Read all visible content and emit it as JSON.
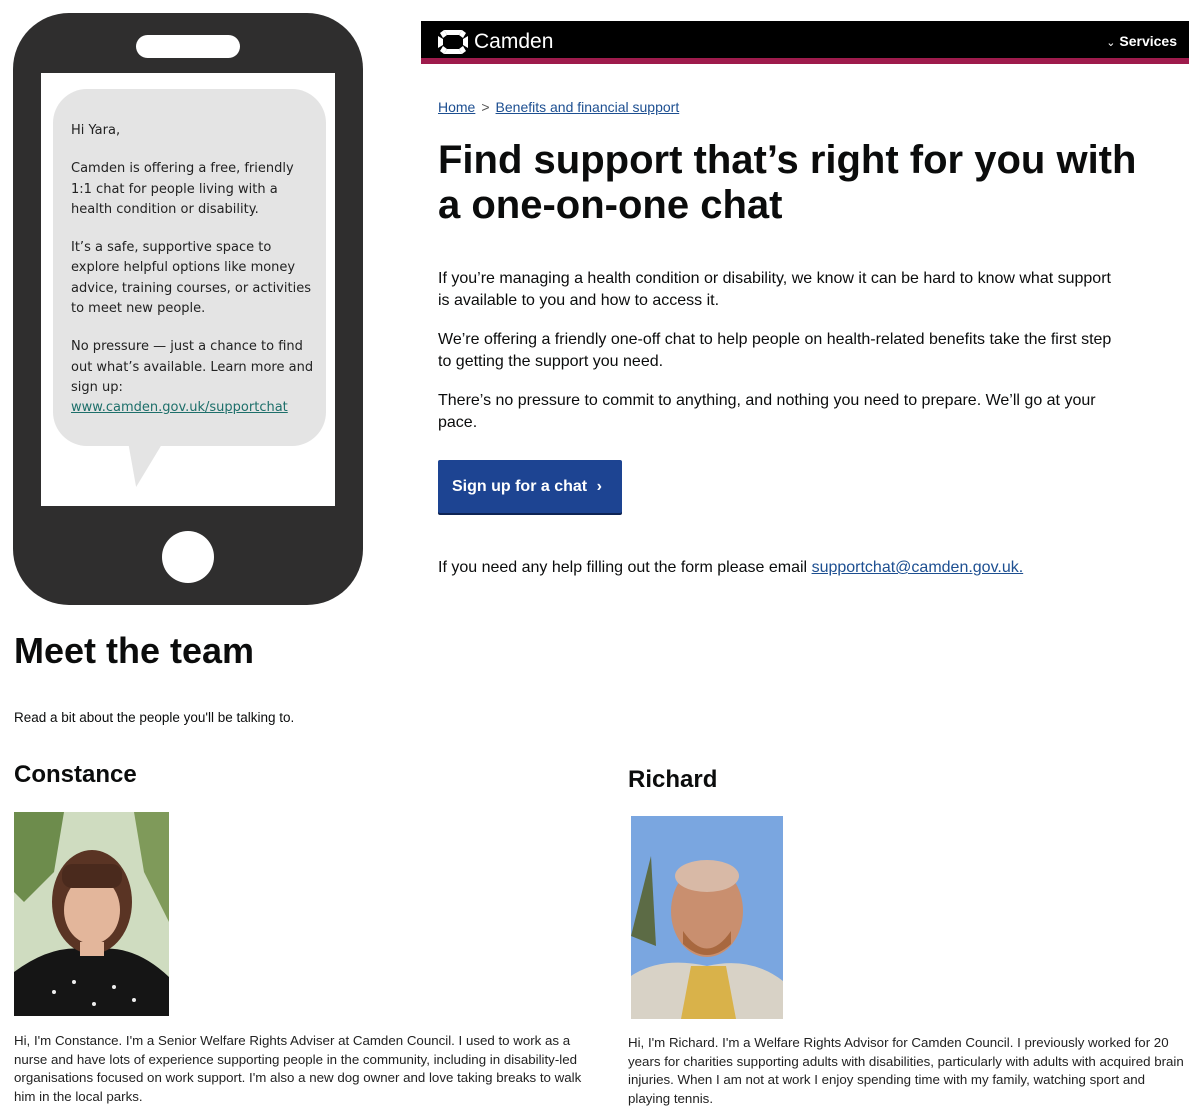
{
  "sms": {
    "greeting": "Hi Yara,",
    "p1": "Camden is offering a free, friendly 1:1 chat for people living with a health condition or disability.",
    "p2": "It’s a safe, supportive space to explore helpful options like  money advice, training courses, or activities to meet new people.",
    "p3": "No pressure — just a chance to find out what’s available. Learn more and sign up:",
    "link": "www.camden.gov.uk/supportchat"
  },
  "header": {
    "logo_text": "Camden",
    "services_label": "Services",
    "colors": {
      "bar": "#000000",
      "accent": "#9e1b4c"
    }
  },
  "breadcrumb": {
    "home": "Home",
    "separator": ">",
    "current": "Benefits and financial support"
  },
  "main": {
    "title": "Find support that’s right for you with a one-on-one chat",
    "p1": "If you’re managing a health condition or disability, we know it can be hard to know what support is available to you and how to access it.",
    "p2": "We’re offering a friendly one-off chat to help people on health-related benefits take the first step to getting the support you need.",
    "p3": "There’s no pressure to commit to anything, and nothing you need to prepare. We’ll go at your pace.",
    "cta_label": "Sign up for a chat",
    "help_text": "If you need any help filling out the form please email",
    "help_email": "supportchat@camden.gov.uk.",
    "cta_color": "#1d4492"
  },
  "team": {
    "title": "Meet the team",
    "intro": "Read a bit about the people you'll be talking to.",
    "members": [
      {
        "name": "Constance",
        "bio": "Hi, I'm Constance. I'm a Senior Welfare Rights Adviser at Camden Council. I used to work as a nurse and have lots of experience supporting people in the community, including in disability-led organisations focused on work support. I'm also a new dog owner and love taking breaks to walk him in the local parks."
      },
      {
        "name": "Richard",
        "bio": "Hi, I'm Richard. I'm a Welfare Rights Advisor for Camden Council. I previously worked for 20 years for charities supporting adults with disabilities, particularly with adults with acquired brain injuries. When I am not at work I enjoy spending time with my family, watching sport and playing tennis."
      }
    ]
  }
}
